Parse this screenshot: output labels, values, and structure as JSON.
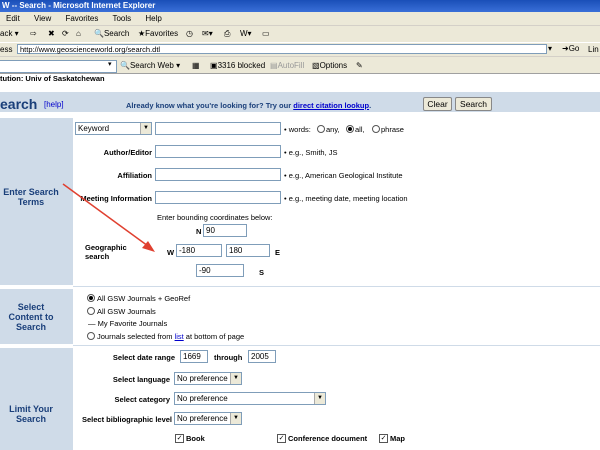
{
  "window": {
    "title": "W -- Search - Microsoft Internet Explorer"
  },
  "menu": [
    "Edit",
    "View",
    "Favorites",
    "Tools",
    "Help"
  ],
  "toolbar": {
    "back": "ack",
    "search": "Search",
    "favorites": "Favorites"
  },
  "address": {
    "label": "ess",
    "url": "http://www.geoscienceworld.org/search.dtl",
    "go": "Go",
    "links": "Lin"
  },
  "linksbar": {
    "search_web": "Search Web",
    "blocked": "3316 blocked",
    "autofill": "AutoFill",
    "options": "Options"
  },
  "institution": "tution: Univ of Saskatchewan",
  "header": {
    "title": "earch",
    "help": "[help]",
    "already_prefix": "Already know what you're looking for? Try our ",
    "already_link": "direct citation lookup",
    "already_suffix": ".",
    "clear": "Clear",
    "search": "Search"
  },
  "enter_terms": {
    "label": "Enter Search Terms",
    "field_type": "Keyword",
    "words_label": "words:",
    "word_options": [
      "any,",
      "all,",
      "phrase"
    ],
    "word_selected": 1,
    "author_label": "Author/Editor",
    "author_hint": "e.g., Smith, JS",
    "affil_label": "Affiliation",
    "affil_hint": "e.g., American Geological Institute",
    "meeting_label": "Meeting Information",
    "meeting_hint": "e.g., meeting date, meeting location",
    "geo_instr": "Enter bounding coordinates below:",
    "geo_label": "Geographic search",
    "n": "N",
    "n_val": "90",
    "w": "W",
    "w_val": "-180",
    "e": "E",
    "e_val": "180",
    "s": "S",
    "s_val": "-90"
  },
  "content": {
    "label": "Select Content to Search",
    "options": [
      "All GSW Journals + GeoRef",
      "All GSW Journals",
      "My Favorite Journals",
      "Journals selected from "
    ],
    "list_link": "list",
    "list_suffix": " at bottom of page",
    "selected": 0
  },
  "limit": {
    "label": "Limit Your Search",
    "date_label": "Select date range",
    "date_from": "1669",
    "through": "through",
    "date_to": "2005",
    "lang_label": "Select language",
    "lang_val": "No preference",
    "cat_label": "Select category",
    "cat_val": "No preference",
    "level_label": "Select bibliographic level",
    "level_val": "No preference",
    "checks": [
      "Book",
      "Conference document",
      "Map"
    ]
  },
  "colors": {
    "panel": "#cfdbe8",
    "heading": "#1a3f7a",
    "link": "#0000cc",
    "arrow": "#e04030"
  }
}
